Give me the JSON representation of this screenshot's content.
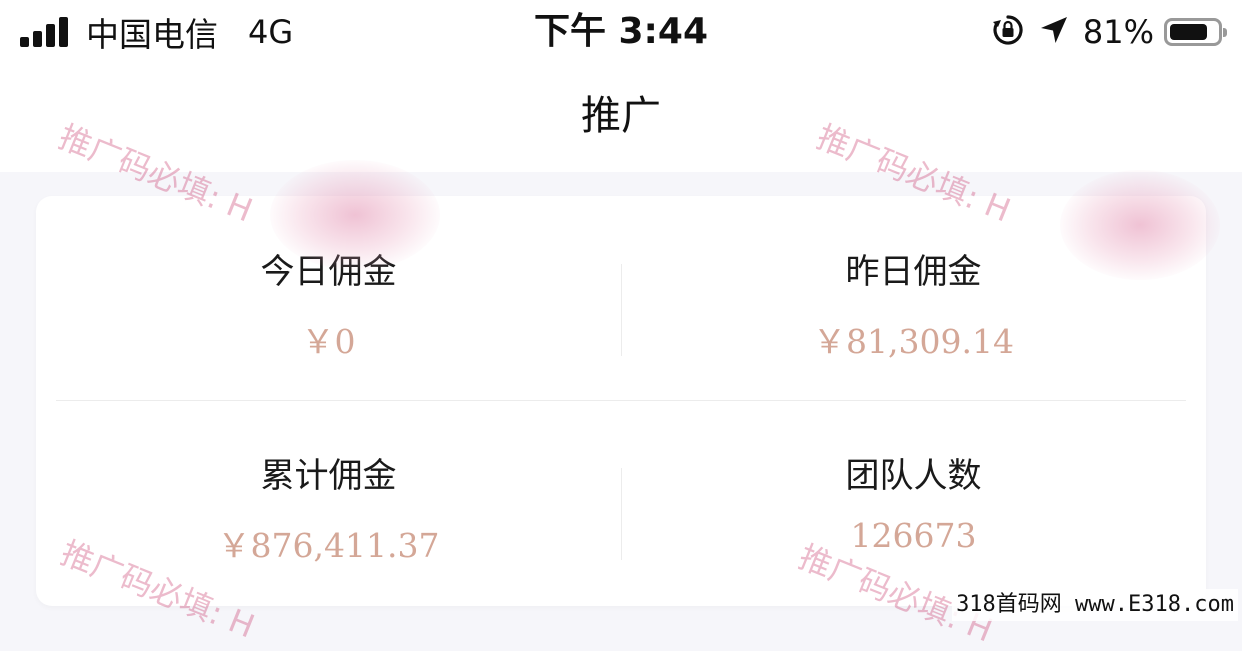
{
  "status_bar": {
    "carrier": "中国电信",
    "network": "4G",
    "time": "下午 3:44",
    "battery_percent": "81%",
    "battery_level": 0.81,
    "icons": [
      "signal-icon",
      "orientation-lock-icon",
      "location-arrow-icon",
      "battery-icon"
    ]
  },
  "nav": {
    "title": "推广"
  },
  "stats": {
    "today": {
      "label": "今日佣金",
      "value": "￥0"
    },
    "yesterday": {
      "label": "昨日佣金",
      "value": "￥81,309.14"
    },
    "total": {
      "label": "累计佣金",
      "value": "￥876,411.37"
    },
    "team": {
      "label": "团队人数",
      "value": "126673"
    }
  },
  "watermark": {
    "text": "推广码必填: H",
    "color": "#c83c6e"
  },
  "footer": {
    "site_mark": "318首码网 www.E318.com"
  },
  "colors": {
    "value_text": "#d4a797",
    "background": "#f6f6fa",
    "card": "#ffffff"
  }
}
